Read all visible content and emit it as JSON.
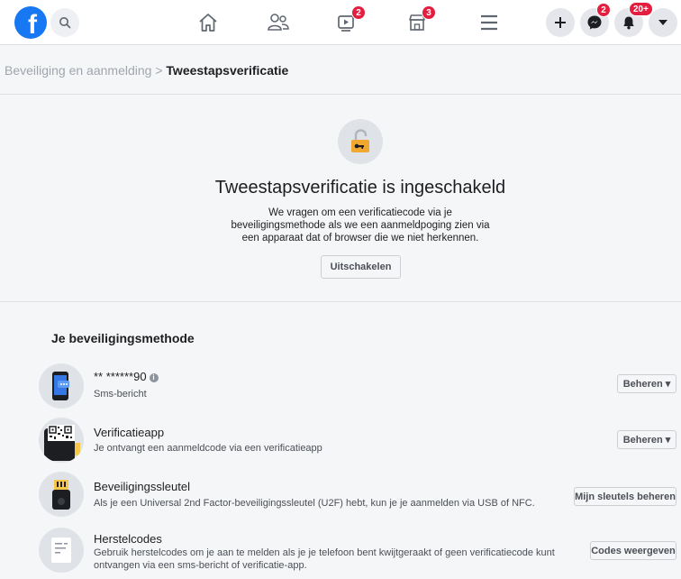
{
  "nav": {
    "badges": {
      "watch": "2",
      "marketplace": "3",
      "messenger": "2",
      "notifications": "20+"
    }
  },
  "breadcrumb": {
    "parent": "Beveiliging en aanmelding",
    "separator": ">",
    "current": "Tweestapsverificatie"
  },
  "hero": {
    "title": "Tweestapsverificatie is ingeschakeld",
    "description_lines": [
      "We vragen om een verificatiecode via je",
      "beveiligingsmethode als we een aanmeldpoging zien via",
      "een apparaat dat of browser die we niet herkennen."
    ],
    "disable_button": "Uitschakelen"
  },
  "methods_section": {
    "title": "Je beveiligingsmethode",
    "items": [
      {
        "title": "** ******90",
        "description": "Sms-bericht",
        "button": "Beheren ▾",
        "icon": "phone-icon"
      },
      {
        "title": "Verificatieapp",
        "description": "Je ontvangt een aanmeldcode via een verificatieapp",
        "button": "Beheren ▾",
        "icon": "qr-code-icon"
      },
      {
        "title": "Beveiligingssleutel",
        "description": "Als je een Universal 2nd Factor-beveiligingssleutel (U2F) hebt, kun je je aanmelden via USB of NFC.",
        "button": "Mijn sleutels beheren",
        "icon": "security-key-icon"
      },
      {
        "title": "Herstelcodes",
        "description_lines": [
          "Gebruik herstelcodes om je aan te melden als je je telefoon bent kwijtgeraakt of geen verificatiecode kunt",
          "ontvangen via een sms-bericht of verificatie-app."
        ],
        "button": "Codes weergeven",
        "icon": "document-icon"
      }
    ]
  },
  "colors": {
    "brand": "#1877f2",
    "badge": "#e41e3f",
    "lock": "#f0a830"
  }
}
